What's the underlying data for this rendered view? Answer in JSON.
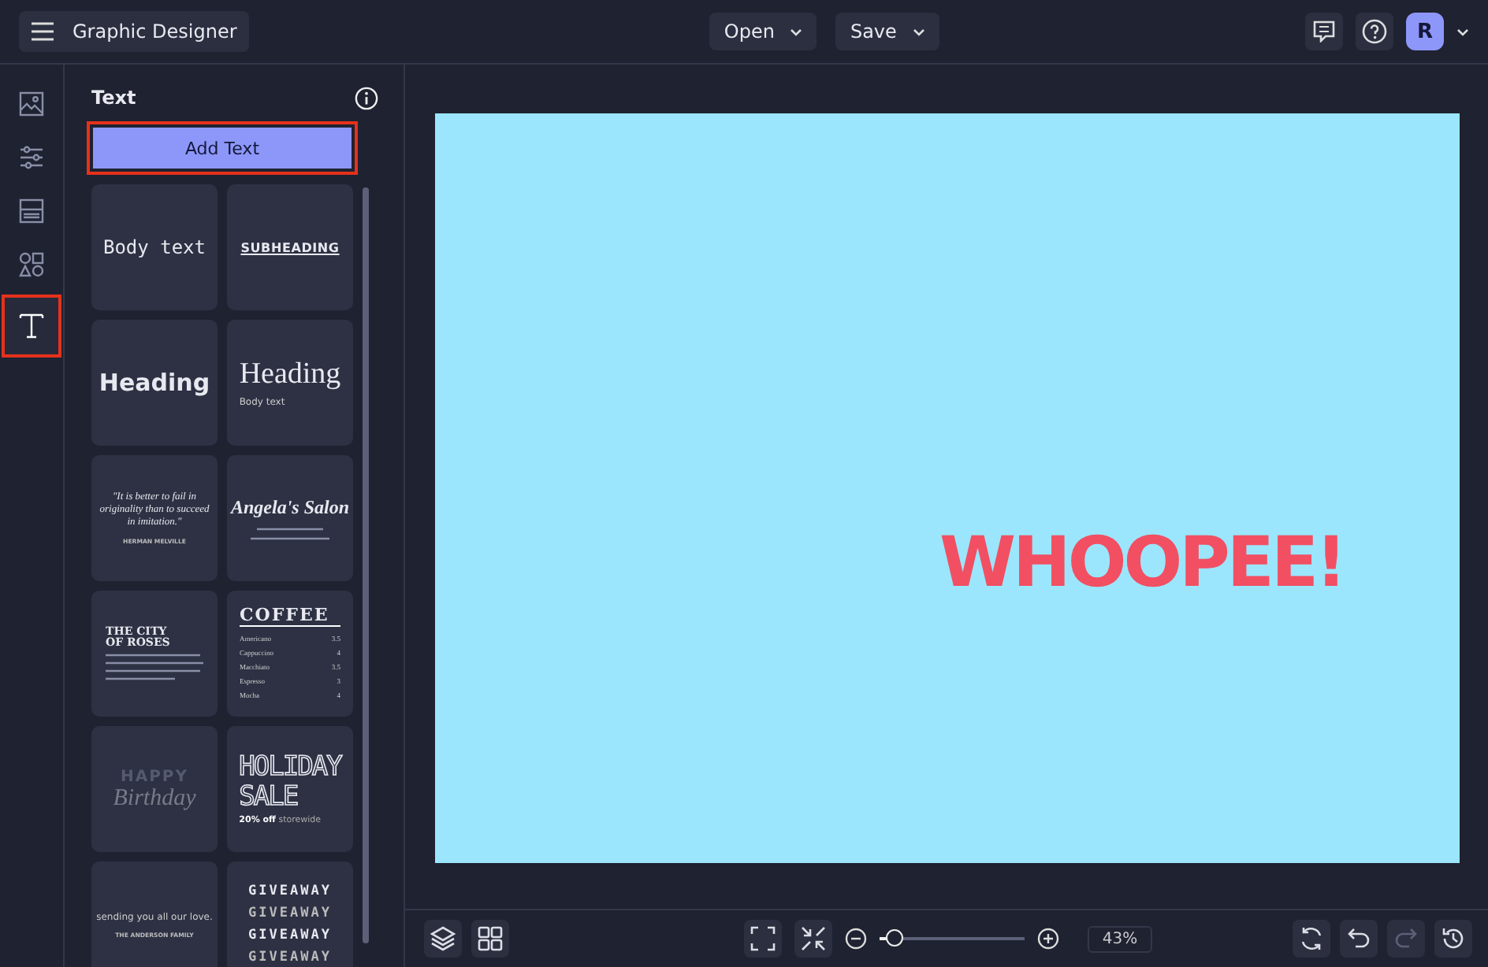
{
  "topbar": {
    "app_title": "Graphic Designer",
    "menus": [
      "Open",
      "Save"
    ],
    "avatar": "R"
  },
  "rail": [
    {
      "kind": "image",
      "selected": false
    },
    {
      "kind": "sliders",
      "selected": false
    },
    {
      "kind": "layout",
      "selected": false
    },
    {
      "kind": "shapes",
      "selected": false
    },
    {
      "kind": "text",
      "selected": true
    }
  ],
  "panel": {
    "title": "Text",
    "add_button": {
      "label": "Add Text",
      "highlighted": true
    },
    "tiles": [
      {
        "kind": "body",
        "text": "Body text"
      },
      {
        "kind": "subheading",
        "text": "SUBHEADING"
      },
      {
        "kind": "bold",
        "text": "Heading"
      },
      {
        "kind": "serif",
        "text": "Heading",
        "sub": "Body text"
      },
      {
        "kind": "quote",
        "text": "\"It is better to fail in originality than to succeed in imitation.\"",
        "sub": "HERMAN MELVILLE"
      },
      {
        "kind": "salon",
        "text": "Angela's Salon"
      },
      {
        "kind": "city",
        "lines": [
          "THE CITY",
          "OF ROSES"
        ]
      },
      {
        "kind": "menu",
        "text": "COFFEE",
        "items": [
          {
            "name": "Americano",
            "price": "3.5"
          },
          {
            "name": "Cappuccino",
            "price": "4"
          },
          {
            "name": "Macchiato",
            "price": "3.5"
          },
          {
            "name": "Espresso",
            "price": "3"
          },
          {
            "name": "Mocha",
            "price": "4"
          }
        ]
      },
      {
        "kind": "birthday",
        "lines": [
          "HAPPY",
          "Birthday"
        ]
      },
      {
        "kind": "sale",
        "lines": [
          "HOLIDAY",
          "SALE"
        ],
        "sub": "**20% off** storewide"
      },
      {
        "kind": "family",
        "text": "sending you all our love.",
        "sub": "THE ANDERSON FAMILY"
      },
      {
        "kind": "giveaway",
        "lines": [
          "GIVEAWAY",
          "GIVEAWAY",
          "GIVEAWAY",
          "GIVEAWAY"
        ]
      }
    ]
  },
  "canvas": {
    "text": "WHOOPEE!"
  },
  "bottombar": {
    "left_tools": [
      {
        "kind": "layers",
        "disabled": false
      },
      {
        "kind": "grid",
        "disabled": false
      }
    ],
    "view_tools": [
      {
        "kind": "fit",
        "disabled": false
      },
      {
        "kind": "shrink",
        "disabled": false
      }
    ],
    "zoom": {
      "level": 0.1,
      "reading": "43%"
    },
    "right_tools": [
      {
        "kind": "refresh",
        "disabled": false
      },
      {
        "kind": "undo",
        "disabled": false
      },
      {
        "kind": "redo",
        "disabled": true
      },
      {
        "kind": "history",
        "disabled": false
      }
    ]
  }
}
